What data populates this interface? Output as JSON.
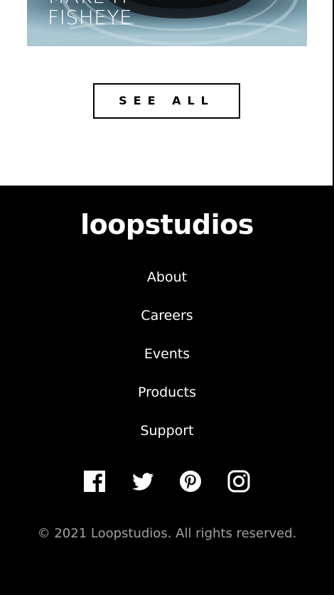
{
  "creation_card": {
    "title_line_1": "MAKE IT",
    "title_line_2": "FISHEYE"
  },
  "see_all": {
    "label": "SEE ALL"
  },
  "footer": {
    "logo": "loopstudios",
    "nav": [
      {
        "label": "About"
      },
      {
        "label": "Careers"
      },
      {
        "label": "Events"
      },
      {
        "label": "Products"
      },
      {
        "label": "Support"
      }
    ],
    "socials": [
      {
        "icon": "facebook-icon"
      },
      {
        "icon": "twitter-icon"
      },
      {
        "icon": "pinterest-icon"
      },
      {
        "icon": "instagram-icon"
      }
    ],
    "copyright": "© 2021 Loopstudios. All rights reserved."
  },
  "colors": {
    "footer_background": "#000000",
    "footer_text": "#ffffff",
    "copyright_text": "#a1a1a1",
    "button_border": "#000000"
  }
}
